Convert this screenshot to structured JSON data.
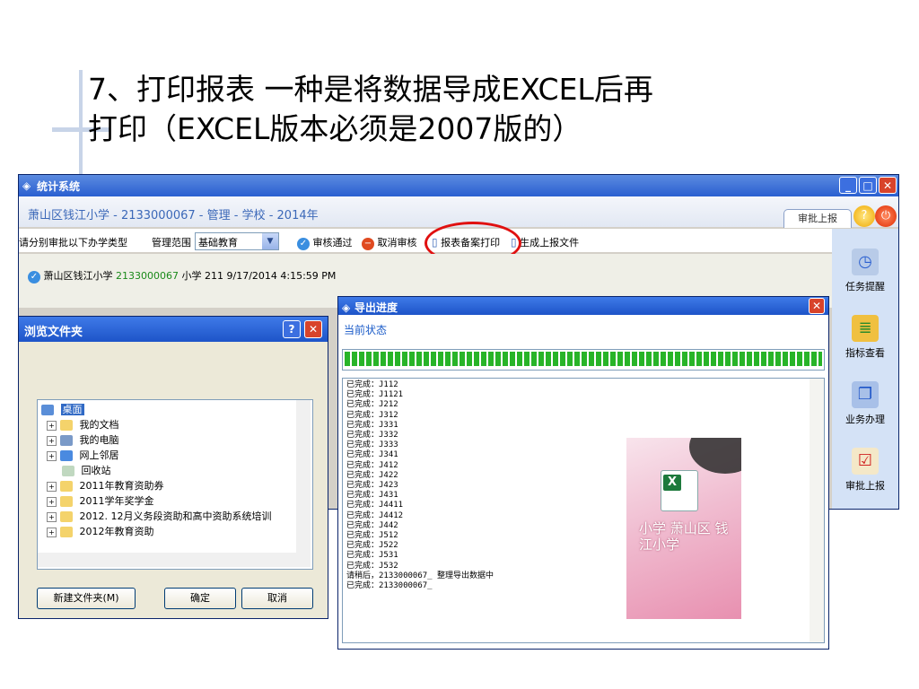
{
  "slide": {
    "title_line1": "7、打印报表  一种是将数据导成EXCEL后再",
    "title_line2": "打印（EXCEL版本必须是2007版的）"
  },
  "main_window": {
    "title": "统计系统",
    "school_line": "萧山区钱江小学 - 2133000067 - 管理 - 学校 - 2014年",
    "tab_label": "审批上报",
    "toolbar": {
      "prompt": "请分别审批以下办学类型",
      "scope_label": "管理范围",
      "scope_value": "基础教育",
      "approve": "审核通过",
      "cancel": "取消审核",
      "print": "报表备案打印",
      "generate": "生成上报文件"
    },
    "status": {
      "school": "萧山区钱江小学",
      "code": "2133000067",
      "rest": "小学  211  9/17/2014 4:15:59 PM"
    },
    "right_panel": [
      "任务提醒",
      "指标查看",
      "业务办理",
      "审批上报"
    ]
  },
  "browse_dialog": {
    "title": "浏览文件夹",
    "tree": [
      {
        "label": "桌面",
        "selected": true
      },
      {
        "label": "我的文档"
      },
      {
        "label": "我的电脑"
      },
      {
        "label": "网上邻居"
      },
      {
        "label": "回收站"
      },
      {
        "label": "2011年教育资助券"
      },
      {
        "label": "2011学年奖学金"
      },
      {
        "label": "2012. 12月义务段资助和高中资助系统培训"
      },
      {
        "label": "2012年教育资助"
      }
    ],
    "new_folder": "新建文件夹(M)",
    "ok": "确定",
    "cancel": "取消"
  },
  "progress_dialog": {
    "title": "导出进度",
    "status_label": "当前状态",
    "progress": 1.0,
    "log": [
      "已完成：J112",
      "已完成：J1121",
      "已完成：J212",
      "已完成：J312",
      "已完成：J331",
      "已完成：J332",
      "已完成：J333",
      "已完成：J341",
      "已完成：J412",
      "已完成：J422",
      "已完成：J423",
      "已完成：J431",
      "已完成：J4411",
      "已完成：J4412",
      "已完成：J442",
      "已完成：J512",
      "已完成：J522",
      "已完成：J531",
      "已完成：J532",
      "请稍后，2133000067_  整理导出数据中",
      "已完成：2133000067_"
    ]
  },
  "excel_thumb": {
    "label": "小学 萧山区 钱江小学"
  },
  "colors": {
    "title_bar": "#2a5fd0",
    "highlight_circle": "#e01010",
    "progress_green": "#28b428"
  }
}
